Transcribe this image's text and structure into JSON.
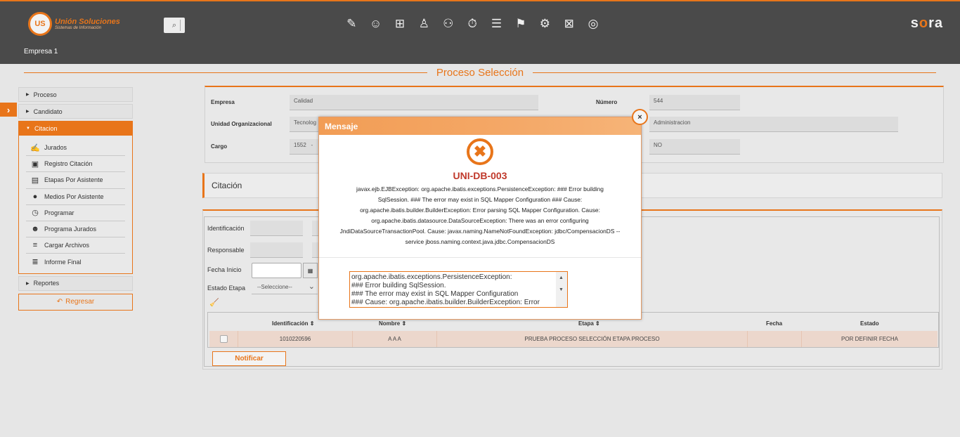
{
  "header": {
    "logo_initials": "US",
    "logo_name": "Unión Soluciones",
    "logo_tagline": "Sistemas de Información",
    "company": "Empresa 1",
    "brand_prefix": "s",
    "brand_accent": "o",
    "brand_suffix": "ra",
    "search_icon": "⌕",
    "nav_icons": [
      "document-edit-icon",
      "user-settings-icon",
      "gift-icon",
      "org-chart-icon",
      "user-id-icon",
      "stopwatch-icon",
      "report-icon",
      "presentation-icon",
      "gears-icon",
      "briefcase-icon",
      "users-search-icon"
    ],
    "nav_glyphs": [
      "✎",
      "☺",
      "⊞",
      "♙",
      "⚇",
      "⏱",
      "☰",
      "⚑",
      "⚙",
      "⊠",
      "◎"
    ]
  },
  "page": {
    "title": "Proceso Selección"
  },
  "sidebar": {
    "proceso": "Proceso",
    "candidato": "Candidato",
    "citacion": "Citacion",
    "items": [
      {
        "label": "Jurados",
        "icon": "✍"
      },
      {
        "label": "Registro Citación",
        "icon": "▣"
      },
      {
        "label": "Etapas Por Asistente",
        "icon": "▤"
      },
      {
        "label": "Medios Por Asistente",
        "icon": "●"
      },
      {
        "label": "Programar",
        "icon": "◷"
      },
      {
        "label": "Programa Jurados",
        "icon": "☻"
      },
      {
        "label": "Cargar Archivos",
        "icon": "≡"
      },
      {
        "label": "Informe Final",
        "icon": "≣"
      }
    ],
    "reportes": "Reportes",
    "regresar": "Regresar"
  },
  "form": {
    "empresa_label": "Empresa",
    "empresa_value": "Calidad",
    "numero_label": "Número",
    "numero_value": "544",
    "unidad_label": "Unidad Organizacional",
    "unidad_value": "Tecnolog",
    "unidad_right_value": "Administracion",
    "cargo_label": "Cargo",
    "cargo_value": "1552",
    "cargo_dash": "-",
    "cargo_right_value": "NO"
  },
  "citacion": {
    "title": "Citación",
    "identificacion_label": "Identificación",
    "responsable_label": "Responsable",
    "fecha_inicio_label": "Fecha Inicio",
    "estado_etapa_label": "Estado Etapa",
    "estado_etapa_value": "--Seleccione--",
    "calendar_icon": "▦",
    "clear_icon": "🧹"
  },
  "table": {
    "sort_icon": "⇕",
    "headers": [
      "Identificación",
      "Nombre",
      "Etapa",
      "Fecha",
      "Estado"
    ],
    "rows": [
      {
        "identificacion": "1010220596",
        "nombre": "A A A",
        "etapa": "PRUEBA PROCESO SELECCIÓN ETAPA PROCESO",
        "fecha": "",
        "estado": "POR DEFINIR FECHA"
      }
    ],
    "notify": "Notificar"
  },
  "modal": {
    "title": "Mensaje",
    "close_glyph": "×",
    "error_glyph": "✖",
    "code": "UNI-DB-003",
    "message_lines": [
      "javax.ejb.EJBException: org.apache.ibatis.exceptions.PersistenceException: ### Error building",
      "SqlSession. ### The error may exist in SQL Mapper Configuration ### Cause:",
      "org.apache.ibatis.builder.BuilderException: Error parsing SQL Mapper Configuration. Cause:",
      "org.apache.ibatis.datasource.DataSourceException: There was an error configuring",
      "JndiDataSourceTransactionPool. Cause: javax.naming.NameNotFoundException: jdbc/CompensacionDS --",
      "service jboss.naming.context.java.jdbc.CompensacionDS"
    ],
    "detail_lines": [
      "org.apache.ibatis.exceptions.PersistenceException:",
      "### Error building SqlSession.",
      "### The error may exist in SQL Mapper Configuration",
      "### Cause: org.apache.ibatis.builder.BuilderException: Error"
    ]
  },
  "colors": {
    "accent": "#e8751a",
    "header_bg": "#4a4a4a",
    "error_code": "#c0392b",
    "row_highlight": "#ecd7cc"
  }
}
